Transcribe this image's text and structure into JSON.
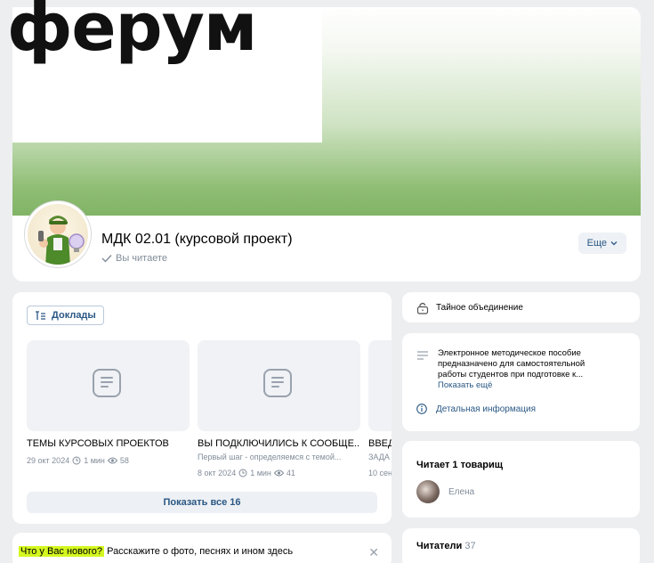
{
  "header": {
    "logo_text": "ферум"
  },
  "community": {
    "title": "МДК 02.01 (курсовой проект)",
    "status": "Вы читаете",
    "more_label": "Еще"
  },
  "articles": {
    "tag_label": "Доклады",
    "items": [
      {
        "title": "ТЕМЫ КУРСОВЫХ ПРОЕКТОВ",
        "subtitle": "",
        "date": "29 окт 2024",
        "read_time": "1 мин",
        "views": "58"
      },
      {
        "title": "ВЫ ПОДКЛЮЧИЛИСЬ К СООБЩЕ...",
        "subtitle": "Первый шаг - определяемся с темой...",
        "date": "8 окт 2024",
        "read_time": "1 мин",
        "views": "41"
      },
      {
        "title": "ВВЕД",
        "subtitle": "ЗАДА",
        "date": "10 сен",
        "read_time": "",
        "views": ""
      }
    ],
    "show_all_label": "Показать все 16"
  },
  "new_post": {
    "prompt_highlight": "Что у Вас нового?",
    "prompt_rest": "Расскажите о фото, песнях и ином здесь",
    "close_glyph": "✕"
  },
  "sidebar": {
    "privacy_label": "Тайное объединение",
    "description_line1": "Электронное методическое пособие",
    "description_line2": "предназначено для самостоятельной",
    "description_line3": "работы студентов при подготовке к...",
    "show_more_label": "Показать ещё",
    "details_label": "Детальная информация",
    "friends_title": "Читает 1 товарищ",
    "friend_name": "Елена",
    "readers_label": "Читатели",
    "readers_count": "37"
  },
  "icons": [
    "lock-icon",
    "list-icon",
    "info-icon",
    "article-icon",
    "clock-icon",
    "eye-icon",
    "checkmark-icon",
    "chevron-down-icon",
    "close-icon"
  ],
  "colors": {
    "link": "#2a5885",
    "muted": "#818c99",
    "background": "#edeef0",
    "highlight": "#d4f71f",
    "cover_green": "#7fb264"
  }
}
